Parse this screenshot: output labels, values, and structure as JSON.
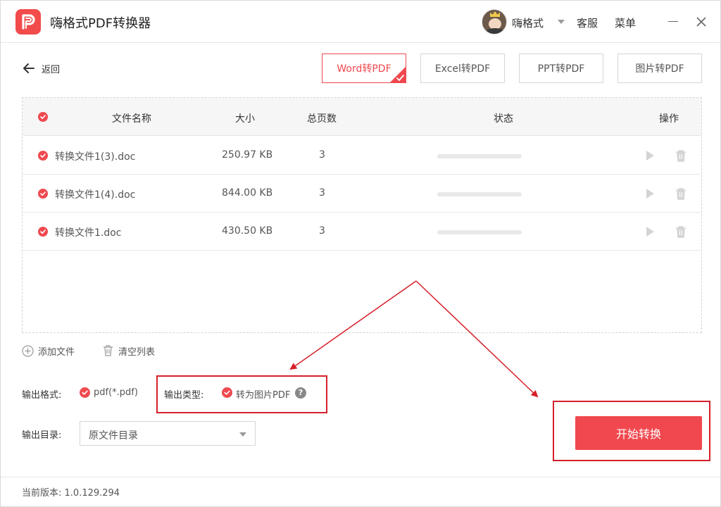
{
  "app": {
    "title": "嗨格式PDF转换器",
    "brand_color": "#f0484e"
  },
  "header": {
    "username": "嗨格式",
    "service_label": "客服",
    "menu_label": "菜单",
    "icons": [
      "app-logo-icon",
      "avatar",
      "chevron-down-icon",
      "minimize-icon",
      "close-icon"
    ]
  },
  "nav": {
    "back_label": "返回"
  },
  "tabs": [
    {
      "label": "Word转PDF",
      "active": true
    },
    {
      "label": "Excel转PDF",
      "active": false
    },
    {
      "label": "PPT转PDF",
      "active": false
    },
    {
      "label": "图片转PDF",
      "active": false
    }
  ],
  "table": {
    "columns": {
      "name": "文件名称",
      "size": "大小",
      "pages": "总页数",
      "status": "状态",
      "actions": "操作"
    },
    "rows": [
      {
        "name": "转换文件1(3).doc",
        "size": "250.97 KB",
        "pages": "3",
        "progress": 0
      },
      {
        "name": "转换文件1(4).doc",
        "size": "844.00 KB",
        "pages": "3",
        "progress": 0
      },
      {
        "name": "转换文件1.doc",
        "size": "430.50 KB",
        "pages": "3",
        "progress": 0
      }
    ]
  },
  "actions": {
    "add_files": "添加文件",
    "clear_list": "清空列表"
  },
  "options": {
    "format_label": "输出格式:",
    "format_value": "pdf(*.pdf)",
    "type_label": "输出类型:",
    "type_value": "转为图片PDF",
    "help_glyph": "?",
    "dir_label": "输出目录:",
    "dir_value": "原文件目录"
  },
  "start_button": "开始转换",
  "footer": {
    "version": "当前版本: 1.0.129.294"
  },
  "annotation_color": "#d6202a"
}
